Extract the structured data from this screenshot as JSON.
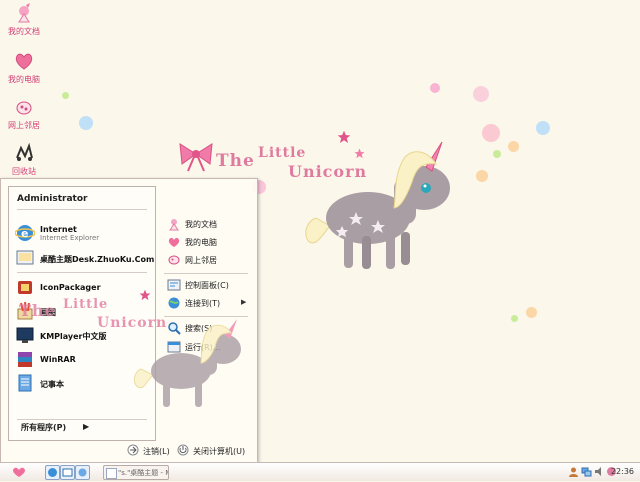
{
  "desktop": {
    "icons": [
      {
        "label": "我的文档",
        "icon": "my-documents-icon"
      },
      {
        "label": "我的电脑",
        "icon": "my-computer-icon"
      },
      {
        "label": "网上邻居",
        "icon": "network-places-icon"
      },
      {
        "label": "回收站",
        "icon": "recycle-bin-icon"
      }
    ]
  },
  "wallpaper": {
    "title_the": "The",
    "title_little": "Little",
    "title_unicorn": "Unicorn"
  },
  "start_menu": {
    "user": "Administrator",
    "pinned": [
      {
        "name": "Internet",
        "sub": "Internet Explorer",
        "icon": "ie-icon"
      },
      {
        "name": "桌酷主题Desk.ZhuoKu.Com",
        "icon": "zhuoku-icon"
      }
    ],
    "recent": [
      {
        "name": "IconPackager",
        "icon": "iconpackager-icon"
      },
      {
        "name": "画图",
        "icon": "paint-icon"
      },
      {
        "name": "KMPlayer中文版",
        "icon": "kmplayer-icon"
      },
      {
        "name": "WinRAR",
        "icon": "winrar-icon"
      },
      {
        "name": "记事本",
        "icon": "notepad-icon"
      }
    ],
    "all_programs": "所有程序(P)",
    "right": [
      {
        "label": "我的文档",
        "icon": "my-documents-icon"
      },
      {
        "label": "我的电脑",
        "icon": "my-computer-icon"
      },
      {
        "label": "网上邻居",
        "icon": "network-places-icon"
      },
      {
        "label": "控制面板(C)",
        "icon": "control-panel-icon"
      },
      {
        "label": "连接到(T)",
        "icon": "connect-to-icon"
      },
      {
        "label": "搜索(S)",
        "icon": "search-icon"
      },
      {
        "label": "运行(R)...",
        "icon": "run-icon"
      }
    ],
    "logoff": "注销(L)",
    "shutdown": "关闭计算机(U)"
  },
  "taskbar": {
    "task_label": "\"s.\"桌酷主题 - Mi...",
    "clock": "22:36"
  },
  "colors": {
    "accent_pink": "#e07ba0",
    "desktop_bg": "#fbf7ea"
  }
}
